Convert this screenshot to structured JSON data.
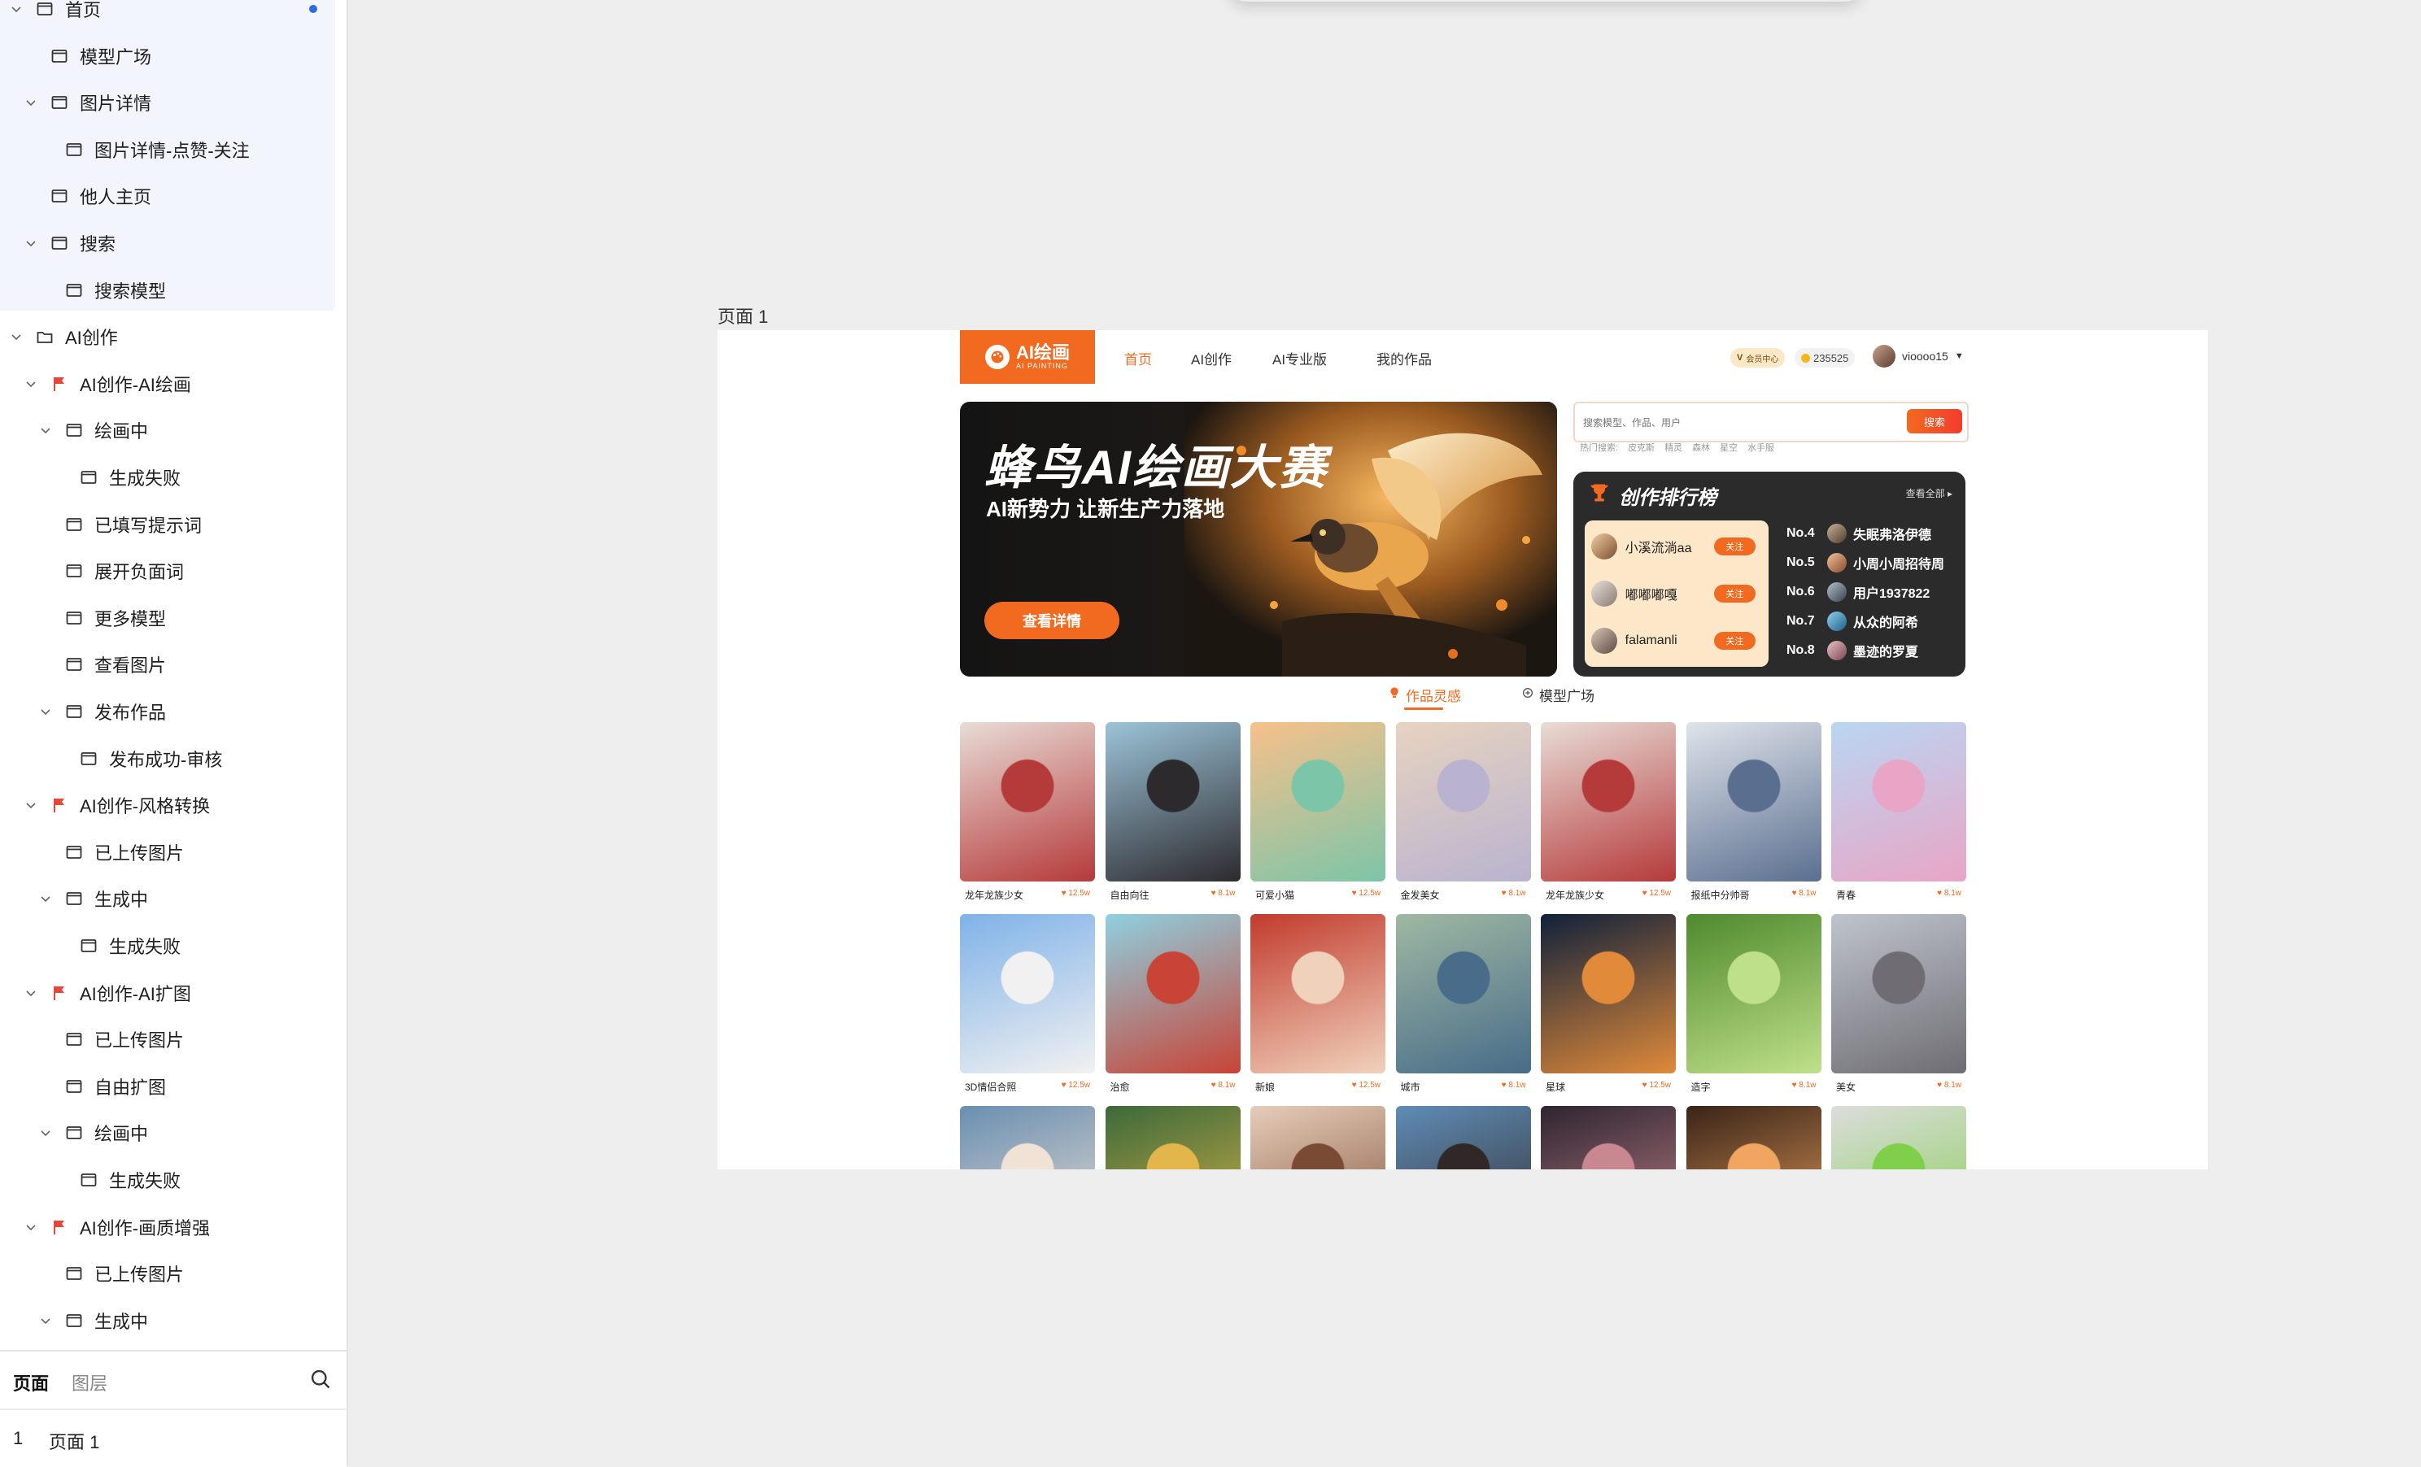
{
  "sidebar": {
    "tree": [
      {
        "label": "首页",
        "type": "page",
        "expanded": true,
        "dot": true
      },
      {
        "label": "模型广场",
        "type": "page"
      },
      {
        "label": "图片详情",
        "type": "page",
        "expanded": true
      },
      {
        "label": "图片详情-点赞-关注",
        "type": "page"
      },
      {
        "label": "他人主页",
        "type": "page"
      },
      {
        "label": "搜索",
        "type": "page",
        "expanded": true
      },
      {
        "label": "搜索模型",
        "type": "page"
      },
      {
        "label": "AI创作",
        "type": "folder",
        "expanded": true
      },
      {
        "label": "AI创作-AI绘画",
        "type": "flag",
        "expanded": true
      },
      {
        "label": "绘画中",
        "type": "page",
        "expanded": true
      },
      {
        "label": "生成失败",
        "type": "page"
      },
      {
        "label": "已填写提示词",
        "type": "page"
      },
      {
        "label": "展开负面词",
        "type": "page"
      },
      {
        "label": "更多模型",
        "type": "page"
      },
      {
        "label": "查看图片",
        "type": "page"
      },
      {
        "label": "发布作品",
        "type": "page",
        "expanded": true
      },
      {
        "label": "发布成功-审核",
        "type": "page"
      },
      {
        "label": "AI创作-风格转换",
        "type": "flag",
        "expanded": true
      },
      {
        "label": "已上传图片",
        "type": "page"
      },
      {
        "label": "生成中",
        "type": "page",
        "expanded": true
      },
      {
        "label": "生成失败",
        "type": "page"
      },
      {
        "label": "AI创作-AI扩图",
        "type": "flag",
        "expanded": true
      },
      {
        "label": "已上传图片",
        "type": "page"
      },
      {
        "label": "自由扩图",
        "type": "page"
      },
      {
        "label": "绘画中",
        "type": "page",
        "expanded": true
      },
      {
        "label": "生成失败",
        "type": "page"
      },
      {
        "label": "AI创作-画质增强",
        "type": "flag",
        "expanded": true
      },
      {
        "label": "已上传图片",
        "type": "page"
      },
      {
        "label": "生成中",
        "type": "page",
        "expanded": true
      }
    ],
    "tabs": {
      "pages": "页面",
      "layers": "图层"
    },
    "page_list": [
      {
        "number": "1",
        "name": "页面 1"
      }
    ]
  },
  "canvas": {
    "frame_label": "页面 1"
  },
  "site": {
    "logo": {
      "title": "AI绘画",
      "subtitle": "AI PAINTING"
    },
    "nav": [
      "首页",
      "AI创作",
      "AI专业版",
      "我的作品"
    ],
    "vip_label": "会员中心",
    "coins": "235525",
    "username": "vioooo15",
    "banner": {
      "title": "蜂鸟AI绘画大赛",
      "subtitle": "AI新势力 让新生产力落地",
      "button": "查看详情"
    },
    "search": {
      "placeholder": "搜索模型、作品、用户",
      "button": "搜索",
      "hot_label": "热门搜索:",
      "hot_terms": [
        "皮克斯",
        "精灵",
        "森林",
        "星空",
        "水手服"
      ]
    },
    "ranking": {
      "title": "创作排行榜",
      "view_all": "查看全部",
      "top3": [
        {
          "name": "小溪流淌aa",
          "follow": "关注"
        },
        {
          "name": "嘟嘟嘟嘎",
          "follow": "关注"
        },
        {
          "name": "falamanli",
          "follow": "关注"
        }
      ],
      "others": [
        {
          "no": "No.4",
          "name": "失眠弗洛伊德"
        },
        {
          "no": "No.5",
          "name": "小周小周招待周"
        },
        {
          "no": "No.6",
          "name": "用户1937822"
        },
        {
          "no": "No.7",
          "name": "从众的阿希"
        },
        {
          "no": "No.8",
          "name": "墨迹的罗夏"
        }
      ]
    },
    "tabs": [
      "作品灵感",
      "模型广场"
    ],
    "works": [
      {
        "title": "龙年龙族少女",
        "likes": "12.5w"
      },
      {
        "title": "自由向往",
        "likes": "8.1w"
      },
      {
        "title": "可爱小猫",
        "likes": "12.5w"
      },
      {
        "title": "金发美女",
        "likes": "8.1w"
      },
      {
        "title": "龙年龙族少女",
        "likes": "12.5w"
      },
      {
        "title": "报纸中分帅哥",
        "likes": "8.1w"
      },
      {
        "title": "青春",
        "likes": "8.1w"
      },
      {
        "title": "3D情侣合照",
        "likes": "12.5w"
      },
      {
        "title": "治愈",
        "likes": "8.1w"
      },
      {
        "title": "新娘",
        "likes": "12.5w"
      },
      {
        "title": "城市",
        "likes": "8.1w"
      },
      {
        "title": "星球",
        "likes": "12.5w"
      },
      {
        "title": "造字",
        "likes": "8.1w"
      },
      {
        "title": "美女",
        "likes": "8.1w"
      },
      {
        "title": "",
        "likes": ""
      },
      {
        "title": "",
        "likes": ""
      },
      {
        "title": "",
        "likes": ""
      },
      {
        "title": "",
        "likes": ""
      },
      {
        "title": "",
        "likes": ""
      },
      {
        "title": "",
        "likes": ""
      },
      {
        "title": "",
        "likes": ""
      }
    ]
  },
  "colors": {
    "accent": "#f26a1f",
    "selection": "#2e6ae6",
    "flag": "#e5483a"
  }
}
